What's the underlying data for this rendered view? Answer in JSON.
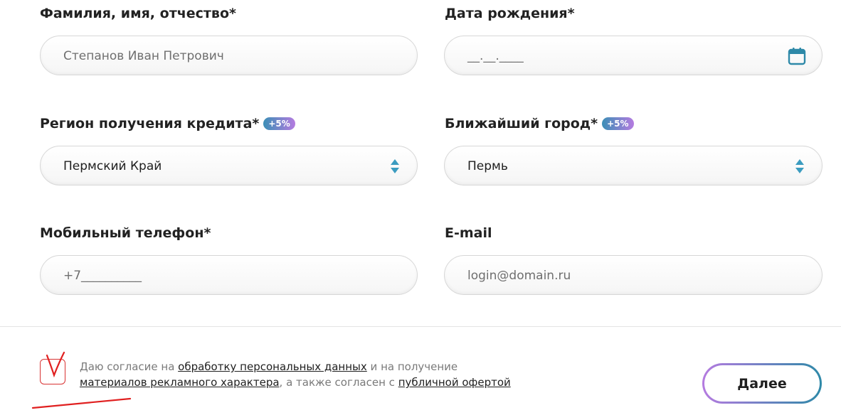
{
  "form": {
    "full_name": {
      "label": "Фамилия, имя, отчество*",
      "placeholder": "Степанов Иван Петрович"
    },
    "birth_date": {
      "label": "Дата рождения*",
      "placeholder": "__.__.____",
      "icon": "calendar-icon"
    },
    "region": {
      "label": "Регион получения кредита*",
      "badge": "+5%",
      "value": "Пермский Край"
    },
    "city": {
      "label": "Ближайший город*",
      "badge": "+5%",
      "value": "Пермь"
    },
    "phone": {
      "label": "Мобильный телефон*",
      "placeholder": "+7__________"
    },
    "email": {
      "label": "E-mail",
      "placeholder": "login@domain.ru"
    }
  },
  "consent": {
    "text_1": "Даю согласие на ",
    "link_1": "обработку персональных данных",
    "text_2": " и на получение ",
    "link_2": "материалов рекламного характера",
    "text_3": ", а также согласен с ",
    "link_3": "публичной офертой"
  },
  "next_button": {
    "label": "Далее"
  },
  "colors": {
    "accent": "#2e89a8",
    "badge_start": "#3b8fb6",
    "badge_end": "#b57be0",
    "annotation": "#e02020"
  }
}
